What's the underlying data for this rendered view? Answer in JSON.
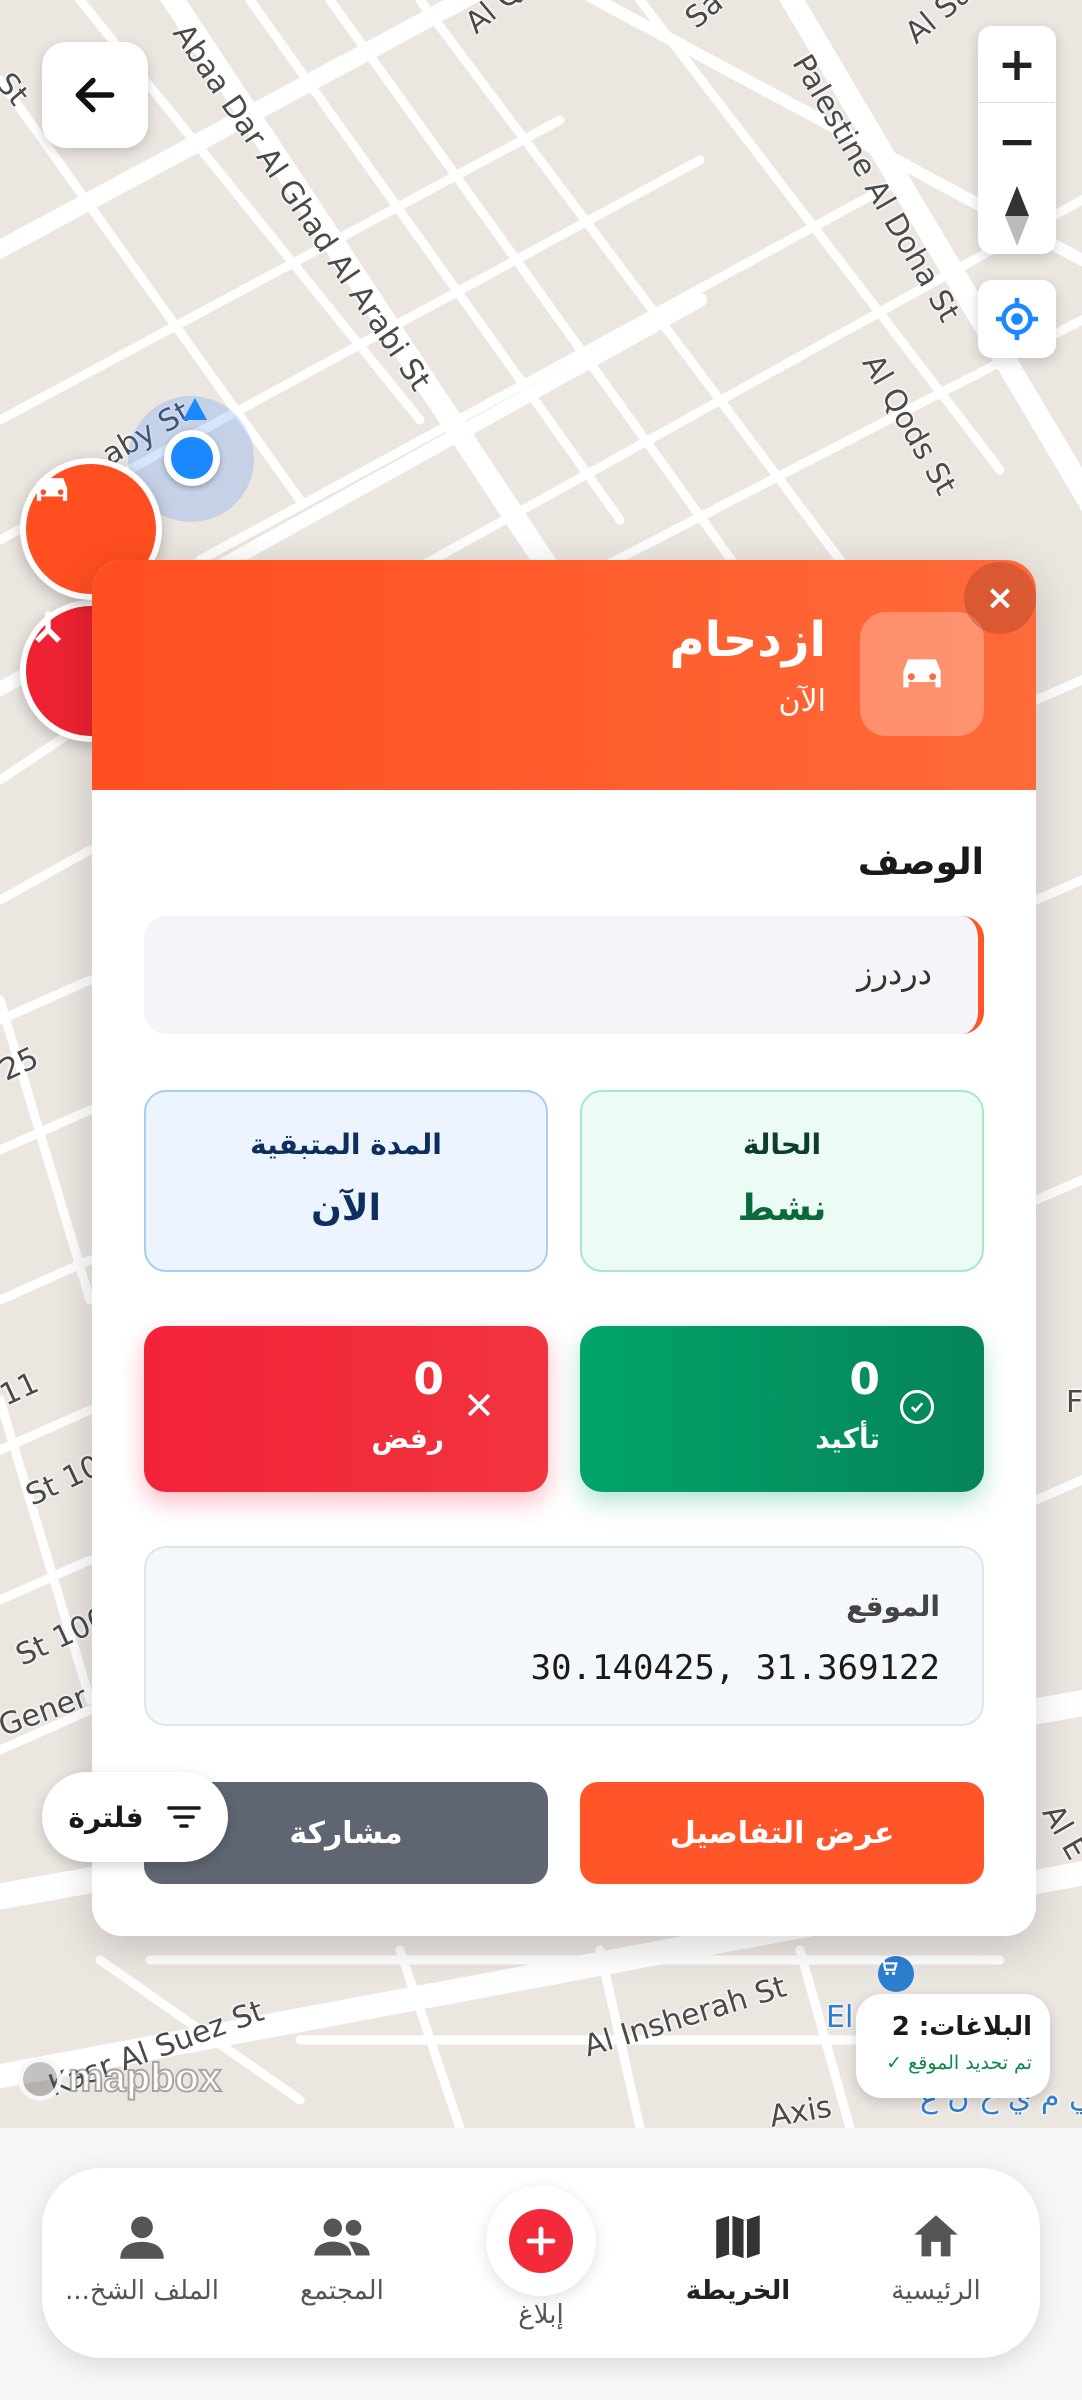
{
  "map": {
    "roads": [
      "Abaa Dar Al Ghad Al Arabi St",
      "Palestine Al Doha St",
      "Al Qods St",
      "Al Insherah St",
      "Kasr Al Suez St",
      "Al Q",
      "Sa",
      "Al Sa",
      "St",
      "aby St",
      "25",
      "11",
      "St 10",
      "St 100",
      "Gener",
      "Al E",
      "F",
      "El",
      "Axis",
      "قي م ي ح ن ع"
    ],
    "attribution": "mapbox"
  },
  "controls": {
    "zoom_in": "+",
    "zoom_out": "−"
  },
  "card": {
    "title": "ازدحام",
    "subtitle": "الآن",
    "close": "×",
    "description_label": "الوصف",
    "description_value": "دردرز",
    "status_label": "الحالة",
    "status_value": "نشط",
    "remaining_label": "المدة المتبقية",
    "remaining_value": "الآن",
    "confirm_count": "0",
    "confirm_label": "تأكيد",
    "reject_count": "0",
    "reject_label": "رفض",
    "location_label": "الموقع",
    "location_value": "30.140425, 31.369122",
    "details_button": "عرض التفاصيل",
    "share_button": "مشاركة"
  },
  "filter": {
    "label": "فلترة"
  },
  "reports_badge": {
    "count_text": "البلاغات: 2",
    "location_status": "تم تحديد الموقع ✓"
  },
  "bottom_nav": {
    "home": "الرئيسية",
    "map": "الخريطة",
    "report": "إبلاغ",
    "community": "المجتمع",
    "profile": "الملف الشخ..."
  },
  "colors": {
    "accent": "#ff5528",
    "danger": "#f22a3a",
    "success": "#02a46a",
    "share": "#5f6672"
  }
}
